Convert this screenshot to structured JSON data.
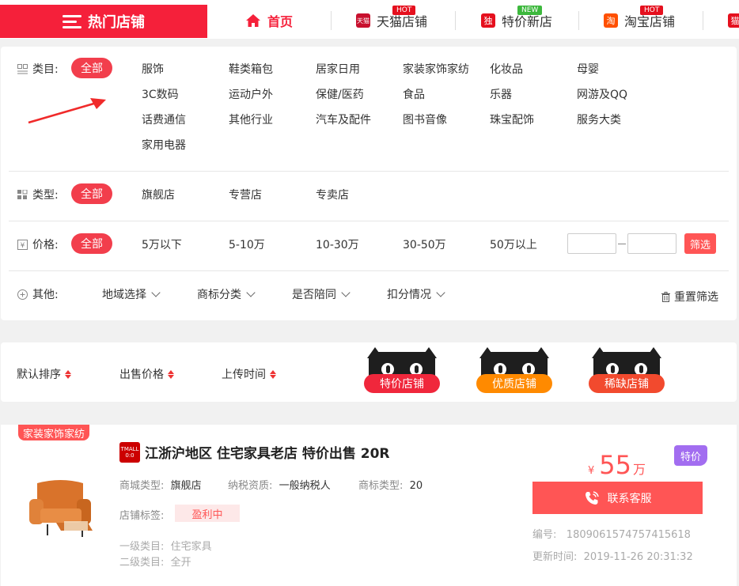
{
  "nav": {
    "hot_label": "热门店铺",
    "tabs": [
      {
        "label": "首页"
      },
      {
        "label": "天猫店铺",
        "icon_text": "天猫",
        "badge": "HOT"
      },
      {
        "label": "特价新店",
        "icon_text": "独",
        "badge": "NEW"
      },
      {
        "label": "淘宝店铺",
        "icon_text": "淘",
        "badge": "HOT"
      },
      {
        "label": "",
        "icon_text": "猫"
      }
    ],
    "colors": {
      "brand": "#f5203a",
      "hot_badge": "#e5101e",
      "new_badge": "#3db83d"
    }
  },
  "filters": {
    "category": {
      "label": "类目:",
      "all": "全部",
      "options": [
        "服饰",
        "鞋类箱包",
        "居家日用",
        "家装家饰家纺",
        "化妆品",
        "母婴",
        "3C数码",
        "运动户外",
        "保健/医药",
        "食品",
        "乐器",
        "网游及QQ",
        "话费通信",
        "其他行业",
        "汽车及配件",
        "图书音像",
        "珠宝配饰",
        "服务大类",
        "家用电器"
      ]
    },
    "type": {
      "label": "类型:",
      "all": "全部",
      "options": [
        "旗舰店",
        "专营店",
        "专卖店"
      ]
    },
    "price": {
      "label": "价格:",
      "all": "全部",
      "options": [
        "5万以下",
        "5-10万",
        "10-30万",
        "30-50万",
        "50万以上"
      ],
      "min_value": "",
      "max_value": "",
      "button": "筛选"
    },
    "other": {
      "label": "其他:",
      "dropdowns": [
        "地域选择",
        "商标分类",
        "是否陪同",
        "扣分情况"
      ],
      "reset": "重置筛选"
    }
  },
  "sort": {
    "options": [
      "默认排序",
      "出售价格",
      "上传时间"
    ],
    "badges": [
      {
        "label": "特价店铺",
        "color": "#f0273c"
      },
      {
        "label": "优质店铺",
        "color": "#ff8a00"
      },
      {
        "label": "稀缺店铺",
        "color": "#f24a2e"
      }
    ]
  },
  "listing": {
    "category_tag": "家装家饰家纺",
    "logo_text_1": "TMALL",
    "logo_text_2": "0:0",
    "title": "江浙沪地区 住宅家具老店 特价出售 20R",
    "mall_type_label": "商城类型:",
    "mall_type": "旗舰店",
    "tax_label": "纳税资质:",
    "tax": "一般纳税人",
    "trademark_label": "商标类型:",
    "trademark": "20",
    "store_tag_label": "店铺标签:",
    "store_tag": "盈利中",
    "cat1_label": "一级类目:",
    "cat1": "住宅家具",
    "cat2_label": "二级类目:",
    "cat2": "全开",
    "special": "特价",
    "price_currency": "¥",
    "price": "55",
    "price_unit": "万",
    "contact": "联系客服",
    "id_label": "编号:",
    "id": "1809061574757415618",
    "updated_label": "更新时间:",
    "updated": "2019-11-26 20:31:32"
  }
}
